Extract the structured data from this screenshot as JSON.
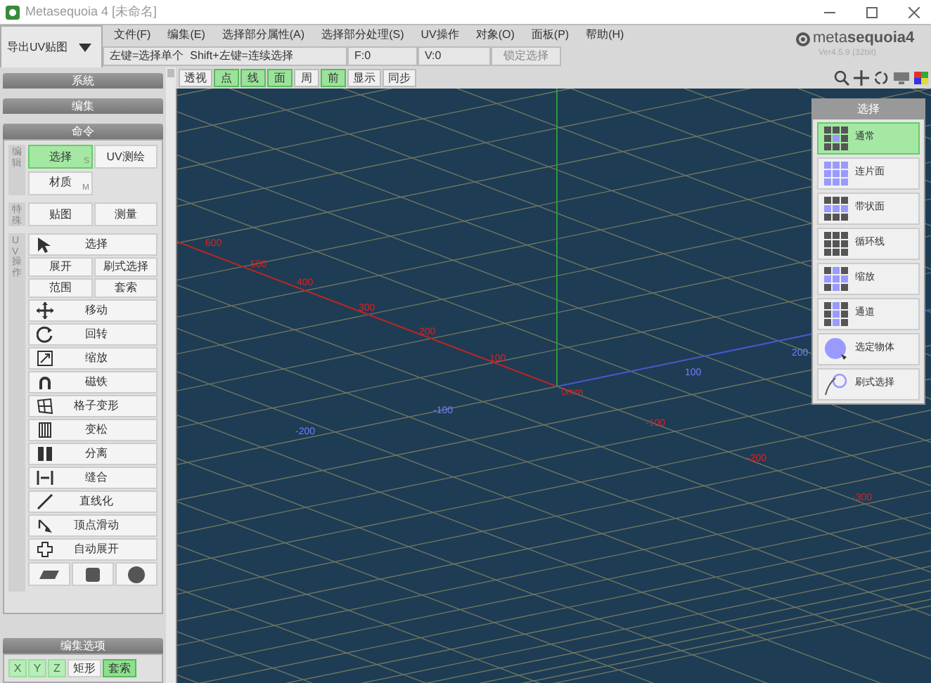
{
  "window": {
    "title": "Metasequoia 4 [未命名]"
  },
  "export_button": {
    "label": "导出UV贴图"
  },
  "menu": [
    "文件(F)",
    "编集(E)",
    "选择部分属性(A)",
    "选择部分处理(S)",
    "UV操作",
    "对象(O)",
    "面板(P)",
    "帮助(H)"
  ],
  "status_bar": {
    "hint": "左键=选择单个  Shift+左键=连续选择",
    "faces": "F:0",
    "vertices": "V:0",
    "lock_button": "锁定选择"
  },
  "logo": {
    "text": "meta**sequoia4**",
    "version": "Ver4.5.9 (32bit)"
  },
  "view_toolbar": [
    {
      "label": "透视",
      "selected": false
    },
    {
      "label": "点",
      "selected": true
    },
    {
      "label": "线",
      "selected": true
    },
    {
      "label": "面",
      "selected": true
    },
    {
      "label": "周",
      "selected": false
    },
    {
      "label": "前",
      "selected": true
    },
    {
      "label": "显示",
      "selected": false
    },
    {
      "label": "同步",
      "selected": false
    }
  ],
  "sidebar": {
    "sections": [
      {
        "title": "系統"
      },
      {
        "title": "编集"
      },
      {
        "title": "命令"
      }
    ],
    "groups": [
      {
        "label": "编辑",
        "buttons": [
          {
            "label": "选择",
            "shortcut": "S",
            "selected": true
          },
          {
            "label": "UV测绘",
            "selected": false
          },
          {
            "label": "材质",
            "shortcut": "M",
            "selected": false
          }
        ]
      },
      {
        "label": "特殊",
        "buttons": [
          {
            "label": "贴图",
            "selected": false
          },
          {
            "label": "测量",
            "selected": false
          }
        ]
      }
    ],
    "uv_group": {
      "label": "UV操作",
      "tools": [
        {
          "kind": "wide",
          "label": "选择"
        },
        {
          "kind": "pair",
          "labels": [
            "展开",
            "刷式选择"
          ]
        },
        {
          "kind": "pair",
          "labels": [
            "范围",
            "套索"
          ]
        },
        {
          "kind": "wide",
          "label": "移动"
        },
        {
          "kind": "wide",
          "label": "回转"
        },
        {
          "kind": "wide",
          "label": "缩放"
        },
        {
          "kind": "wide",
          "label": "磁铁"
        },
        {
          "kind": "wide",
          "label": "格子变形"
        },
        {
          "kind": "wide",
          "label": "变松"
        },
        {
          "kind": "wide",
          "label": "分离"
        },
        {
          "kind": "wide",
          "label": "缝合"
        },
        {
          "kind": "wide",
          "label": "直线化"
        },
        {
          "kind": "wide",
          "label": "顶点滑动"
        },
        {
          "kind": "wide",
          "label": "自动展开"
        },
        {
          "kind": "shapes"
        }
      ]
    },
    "options": {
      "title": "编集选项",
      "toggles": [
        {
          "label": "X",
          "on": true
        },
        {
          "label": "Y",
          "on": true
        },
        {
          "label": "Z",
          "on": true
        },
        {
          "label": "矩形",
          "on": false
        },
        {
          "label": "套索",
          "on": true
        }
      ]
    }
  },
  "viewport": {
    "axis_labels": [
      {
        "text": "600",
        "color": "#e02020"
      },
      {
        "text": "500",
        "color": "#e02020"
      },
      {
        "text": "400",
        "color": "#e02020"
      },
      {
        "text": "300",
        "color": "#e02020"
      },
      {
        "text": "200",
        "color": "#e02020"
      },
      {
        "text": "100",
        "color": "#e02020"
      },
      {
        "text": "0mm",
        "color": "#e02020"
      },
      {
        "text": "100",
        "color": "#7080ff"
      },
      {
        "text": "200",
        "color": "#7080ff"
      },
      {
        "text": "-100",
        "color": "#7080ff"
      },
      {
        "text": "-200",
        "color": "#7080ff"
      },
      {
        "text": "-100",
        "color": "#e02020"
      },
      {
        "text": "-200",
        "color": "#e02020"
      },
      {
        "text": "-300",
        "color": "#e02020"
      }
    ]
  },
  "select_panel": {
    "title": "选择",
    "items": [
      {
        "label": "通常",
        "selected": true
      },
      {
        "label": "连片面",
        "selected": false
      },
      {
        "label": "带状面",
        "selected": false
      },
      {
        "label": "循环线",
        "selected": false
      },
      {
        "label": "缩放",
        "selected": false
      },
      {
        "label": "通道",
        "selected": false
      },
      {
        "label": "选定物体",
        "selected": false
      },
      {
        "label": "刷式选择",
        "selected": false
      }
    ]
  }
}
